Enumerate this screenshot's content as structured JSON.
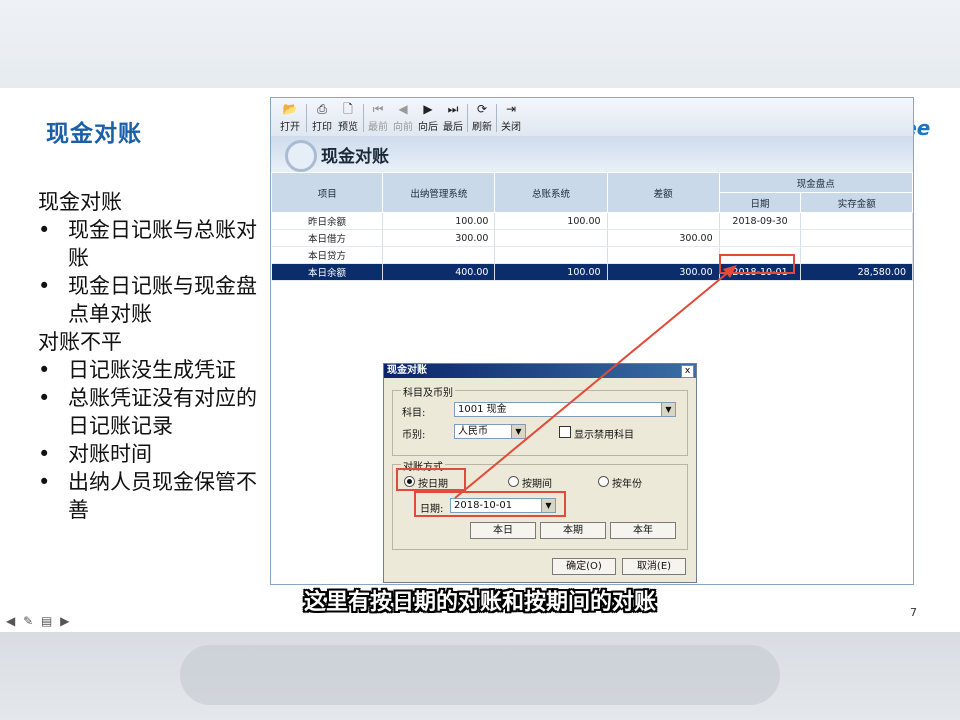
{
  "slide": {
    "title": "现金对账",
    "logo_text": "Kingdee",
    "page_number": "7",
    "bullets": [
      {
        "type": "heading",
        "text": "现金对账"
      },
      {
        "type": "item",
        "text": "现金日记账与总账对账"
      },
      {
        "type": "item",
        "text": "现金日记账与现金盘点单对账"
      },
      {
        "type": "heading",
        "text": "对账不平"
      },
      {
        "type": "item",
        "text": "日记账没生成凭证"
      },
      {
        "type": "item",
        "text": "总账凭证没有对应的日记账记录"
      },
      {
        "type": "item",
        "text": "对账时间"
      },
      {
        "type": "item",
        "text": "出纳人员现金保管不善"
      }
    ],
    "bullet_char": "•"
  },
  "app": {
    "toolbar": [
      "打开",
      "打印",
      "预览",
      "最前",
      "向前",
      "向后",
      "最后",
      "刷新",
      "关闭"
    ],
    "title": "现金对账",
    "table": {
      "headers": {
        "item": "项目",
        "cashier": "出纳管理系统",
        "ledger": "总账系统",
        "diff": "差额",
        "count_group": "现金盘点",
        "date": "日期",
        "actual": "实存金额"
      },
      "rows": [
        {
          "item": "昨日余额",
          "cashier": "100.00",
          "ledger": "100.00",
          "diff": "",
          "date": "2018-09-30",
          "actual": ""
        },
        {
          "item": "本日借方",
          "cashier": "300.00",
          "ledger": "",
          "diff": "300.00",
          "date": "",
          "actual": ""
        },
        {
          "item": "本日贷方",
          "cashier": "",
          "ledger": "",
          "diff": "",
          "date": "",
          "actual": ""
        },
        {
          "item": "本日余额",
          "cashier": "400.00",
          "ledger": "100.00",
          "diff": "300.00",
          "date": "2018-10-01",
          "actual": "28,580.00"
        }
      ]
    }
  },
  "dialog": {
    "title": "现金对账",
    "close": "x",
    "group_subject": "科目及币别",
    "subject_label": "科目:",
    "subject_value": "1001 现金",
    "currency_label": "币别:",
    "currency_value": "人民币",
    "show_disabled": "显示禁用科目",
    "group_mode": "对账方式",
    "mode_date": "按日期",
    "mode_period": "按期间",
    "mode_year": "按年份",
    "date_label": "日期:",
    "date_value": "2018-10-01",
    "btn_today": "本日",
    "btn_period": "本期",
    "btn_year": "本年",
    "btn_ok": "确定(O)",
    "btn_cancel": "取消(E)"
  },
  "subtitle": "这里有按日期的对账和按期间的对账",
  "colors": {
    "accent": "#1b5fa8",
    "highlight": "#e24a3a",
    "selected_row": "#0c2d6b"
  }
}
